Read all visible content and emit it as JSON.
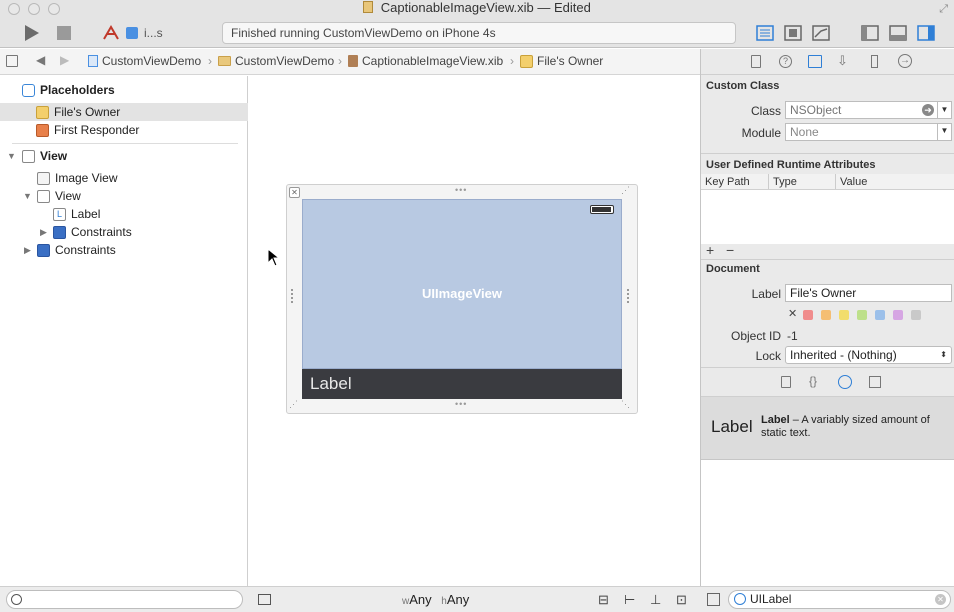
{
  "window": {
    "title": "CaptionableImageView.xib — Edited"
  },
  "toolbar": {
    "scheme_label": "i...s",
    "activity_text": "Finished running CustomViewDemo on iPhone 4s"
  },
  "jumpbar": {
    "crumbs": [
      "CustomViewDemo",
      "CustomViewDemo",
      "CaptionableImageView.xib",
      "File's Owner"
    ]
  },
  "outline": {
    "placeholders_header": "Placeholders",
    "files_owner": "File's Owner",
    "first_responder": "First Responder",
    "view_root": "View",
    "image_view": "Image View",
    "view_child": "View",
    "label": "Label",
    "constraints_inner": "Constraints",
    "constraints_outer": "Constraints"
  },
  "canvas": {
    "image_view_text": "UIImageView",
    "label_text": "Label",
    "size_class_w": "w",
    "size_class_w_value": "Any",
    "size_class_h": "h",
    "size_class_h_value": "Any"
  },
  "inspector": {
    "custom_class_header": "Custom Class",
    "class_label": "Class",
    "class_placeholder": "NSObject",
    "module_label": "Module",
    "module_value": "None",
    "runtime_header": "User Defined Runtime Attributes",
    "col_keypath": "Key Path",
    "col_type": "Type",
    "col_value": "Value",
    "add_label": "+",
    "remove_label": "−",
    "document_header": "Document",
    "doc_label_label": "Label",
    "doc_label_value": "File's Owner",
    "object_id_label": "Object ID",
    "object_id_value": "-1",
    "lock_label": "Lock",
    "lock_value": "Inherited - (Nothing)",
    "library_item_title": "Label",
    "library_item_name": "Label",
    "library_item_desc": " – A variably sized amount of static text.",
    "filter_value": "UILabel"
  },
  "colors": {
    "selection": "#e3e3e3",
    "image_view_fill": "#b8c9e2",
    "label_bar": "#3a3b40",
    "accent_blue": "#2f7fd6",
    "swatches": [
      "#f08c8c",
      "#f5be73",
      "#f2dd6c",
      "#bde08a",
      "#9cc0ea",
      "#d6a6e3",
      "#c9c9c9"
    ]
  }
}
